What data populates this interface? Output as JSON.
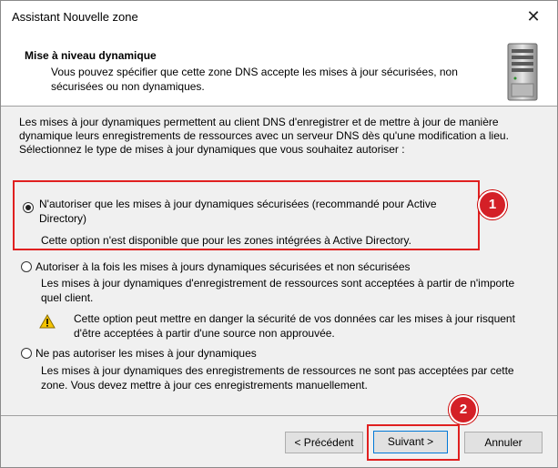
{
  "window": {
    "title": "Assistant Nouvelle zone",
    "close_glyph": "✕"
  },
  "header": {
    "title": "Mise à niveau dynamique",
    "description": "Vous pouvez spécifier que cette zone DNS accepte les mises à jour sécurisées, non sécurisées ou non dynamiques.",
    "icon": "server-icon"
  },
  "intro": {
    "text": "Les mises à jour dynamiques permettent au client DNS d'enregistrer et de mettre à jour de manière dynamique leurs enregistrements de ressources avec un serveur DNS dès qu'une modification a lieu.",
    "prompt": "Sélectionnez le type de mises à jour dynamiques que vous souhaitez autoriser :"
  },
  "options": [
    {
      "label": "N'autoriser que les mises à jour dynamiques sécurisées (recommandé pour Active Directory)",
      "note": "Cette option n'est disponible que pour les zones intégrées à Active Directory.",
      "selected": true
    },
    {
      "label": "Autoriser à la fois les mises à jours dynamiques sécurisées et non sécurisées",
      "note": "Les mises à jour dynamiques d'enregistrement de ressources sont acceptées à partir de n'importe quel client.",
      "warning": "Cette option peut mettre en danger la sécurité de vos données car les mises à jour risquent d'être acceptées à partir d'une source non approuvée.",
      "selected": false
    },
    {
      "label": "Ne pas autoriser les mises à jour dynamiques",
      "note": "Les mises à jour dynamiques des enregistrements de ressources ne sont pas acceptées par cette zone. Vous devez mettre à jour ces enregistrements manuellement.",
      "selected": false
    }
  ],
  "callouts": [
    "1",
    "2"
  ],
  "buttons": {
    "back": "< Précédent",
    "next": "Suivant >",
    "cancel": "Annuler"
  },
  "colors": {
    "highlight": "#e02020",
    "badge": "#d42027",
    "default_button_border": "#0078d7"
  }
}
